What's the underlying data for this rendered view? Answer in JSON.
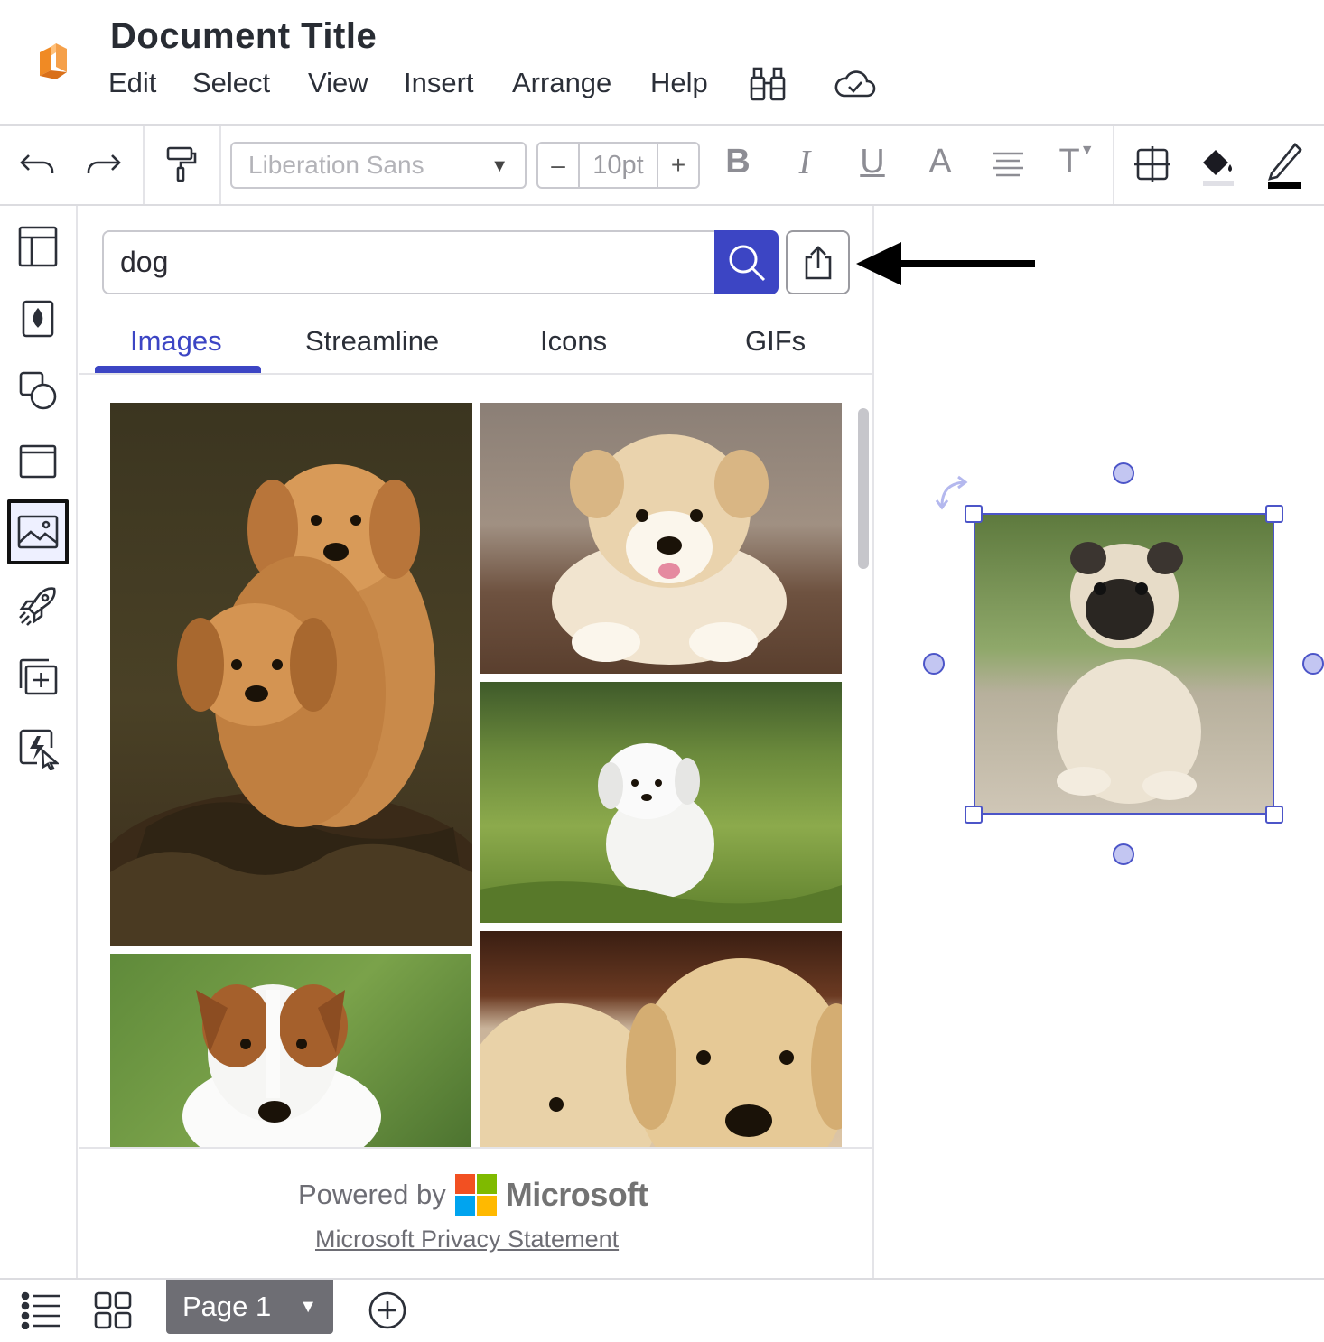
{
  "header": {
    "title": "Document Title",
    "menu": [
      "Edit",
      "Select",
      "View",
      "Insert",
      "Arrange",
      "Help"
    ]
  },
  "toolbar": {
    "font_family": "Liberation Sans",
    "font_size": "10pt",
    "decrement_label": "–",
    "increment_label": "+",
    "bold_label": "B",
    "italic_label": "I",
    "underline_label": "U",
    "font_color_label": "A",
    "text_options_label": "T"
  },
  "panel": {
    "search_value": "dog",
    "tabs": [
      "Images",
      "Streamline",
      "Icons",
      "GIFs"
    ],
    "active_tab": "Images",
    "powered_by": "Powered by",
    "brand": "Microsoft",
    "privacy_link": "Microsoft Privacy Statement"
  },
  "pages": {
    "current": "Page 1"
  },
  "colors": {
    "accent": "#3c45c4",
    "logo_orange": "#f08a24",
    "selection": "#4c55c8"
  }
}
